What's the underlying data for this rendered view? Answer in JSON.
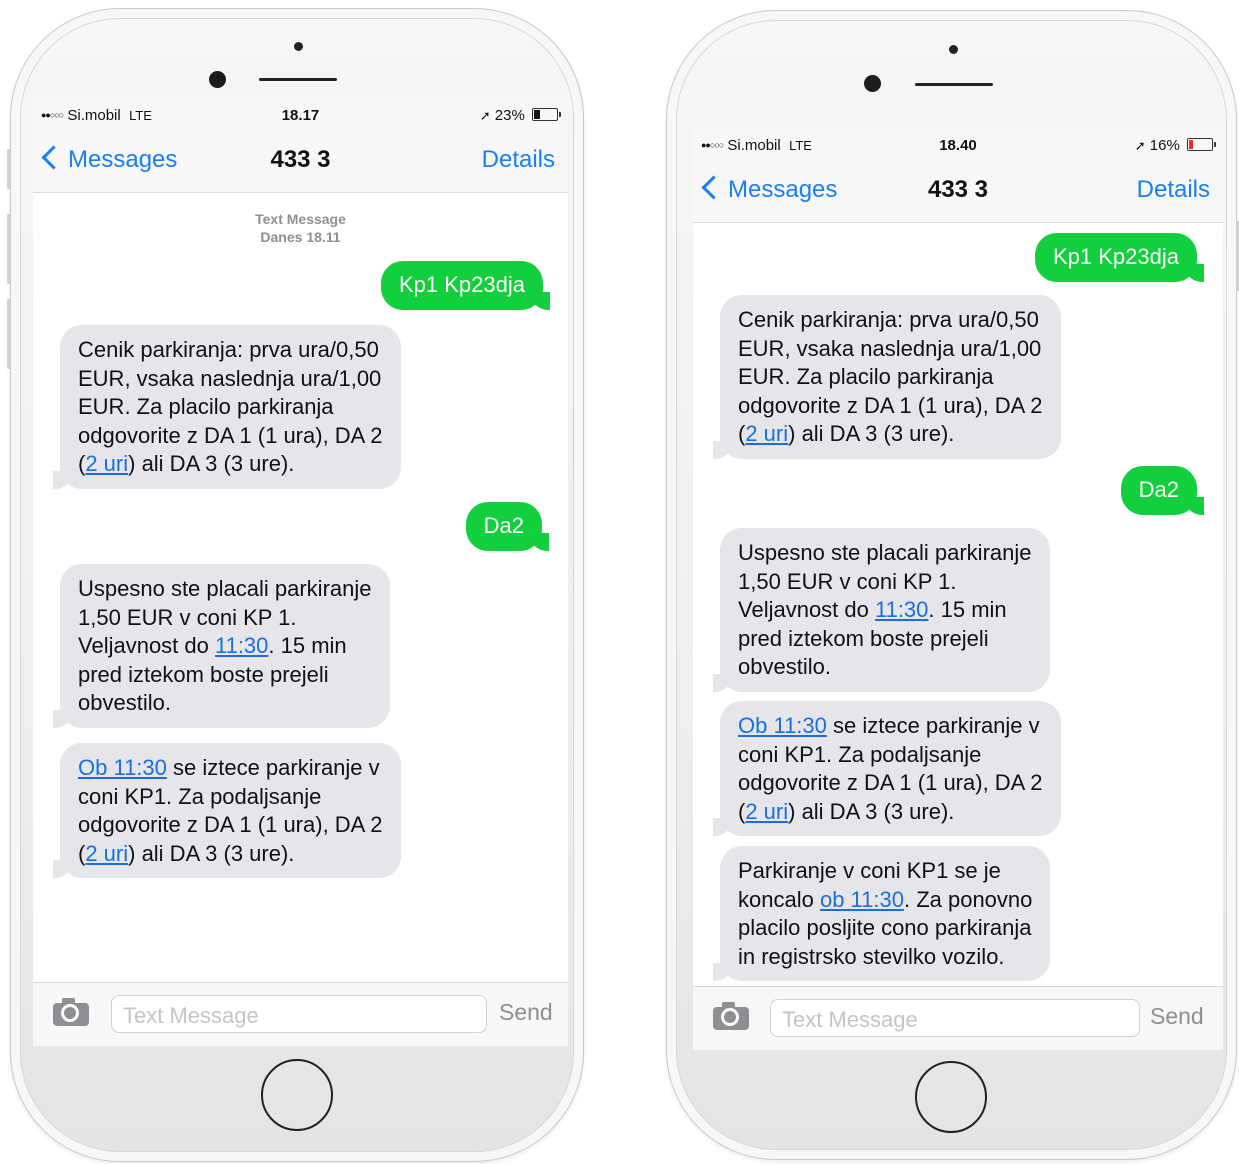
{
  "phones": [
    {
      "status": {
        "signal": "●●○○○",
        "carrier": "Si.mobil",
        "network": "LTE",
        "time": "18.17",
        "location_arrow": "➚",
        "battery": "23%",
        "battery_level": 0.23,
        "battery_color": "#111111"
      },
      "nav": {
        "back_label": "Messages",
        "title": "433 3",
        "details_label": "Details"
      },
      "stamp": {
        "kind": "Text Message",
        "when": "Danes 18.11"
      },
      "msg1": {
        "text": "Kp1 Kp23dja"
      },
      "msg2": {
        "lines": [
          "Cenik parkiranja: prva ura/0,50",
          "EUR, vsaka naslednja ura/1,00",
          "EUR. Za placilo parkiranja",
          "odgovorite z DA 1 (1 ura), DA 2"
        ],
        "l5_a": "(",
        "l5_link": "2 uri",
        "l5_b": ") ali DA 3 (3 ure)."
      },
      "msg3": {
        "text": "Da2"
      },
      "msg4": {
        "l1": "Uspesno ste placali parkiranje",
        "l2": "1,50 EUR v coni KP 1.",
        "l3_a": "Veljavnost do ",
        "l3_link": "11:30",
        "l3_b": ". 15 min",
        "l4": "pred iztekom boste prejeli",
        "l5": "obvestilo."
      },
      "msg5": {
        "l1_link": "Ob 11:30",
        "l1_b": " se iztece parkiranje v",
        "l2": "coni KP1. Za podaljsanje",
        "l3": "odgovorite z DA 1 (1 ura), DA 2",
        "l4_a": "(",
        "l4_link": "2 uri",
        "l4_b": ")  ali DA 3 (3 ure)."
      },
      "input": {
        "placeholder": "Text Message",
        "send_label": "Send"
      }
    },
    {
      "status": {
        "signal": "●●○○○",
        "carrier": "Si.mobil",
        "network": "LTE",
        "time": "18.40",
        "location_arrow": "➚",
        "battery": "16%",
        "battery_level": 0.16,
        "battery_color": "#e5332a"
      },
      "nav": {
        "back_label": "Messages",
        "title": "433 3",
        "details_label": "Details"
      },
      "msg1": {
        "text": "Kp1 Kp23dja"
      },
      "msg2": {
        "lines": [
          "Cenik parkiranja: prva ura/0,50",
          "EUR, vsaka naslednja ura/1,00",
          "EUR. Za placilo parkiranja",
          "odgovorite z DA 1 (1 ura), DA 2"
        ],
        "l5_a": "(",
        "l5_link": "2 uri",
        "l5_b": ") ali DA 3 (3 ure)."
      },
      "msg3": {
        "text": "Da2"
      },
      "msg4": {
        "l1": "Uspesno ste placali parkiranje",
        "l2": "1,50 EUR v coni KP 1.",
        "l3_a": "Veljavnost do ",
        "l3_link": "11:30",
        "l3_b": ". 15 min",
        "l4": "pred iztekom boste prejeli",
        "l5": "obvestilo."
      },
      "msg5": {
        "l1_link": "Ob 11:30",
        "l1_b": " se iztece parkiranje v",
        "l2": "coni KP1. Za podaljsanje",
        "l3": "odgovorite z DA 1 (1 ura), DA 2",
        "l4_a": "(",
        "l4_link": "2 uri",
        "l4_b": ")  ali DA 3 (3 ure)."
      },
      "msg6": {
        "l1": "Parkiranje v coni KP1 se je",
        "l2_a": "koncalo ",
        "l2_link": "ob 11:30",
        "l2_b": ". Za ponovno",
        "l3": "placilo posljite cono parkiranja",
        "l4": "in registrsko stevilko vozilo."
      },
      "input": {
        "placeholder": "Text Message",
        "send_label": "Send"
      }
    }
  ],
  "colors": {
    "imessage_blue": "#1a7ff5",
    "sms_green": "#13cf3d",
    "incoming_gray": "#e5e5ea",
    "link_blue": "#1a6fe0"
  }
}
